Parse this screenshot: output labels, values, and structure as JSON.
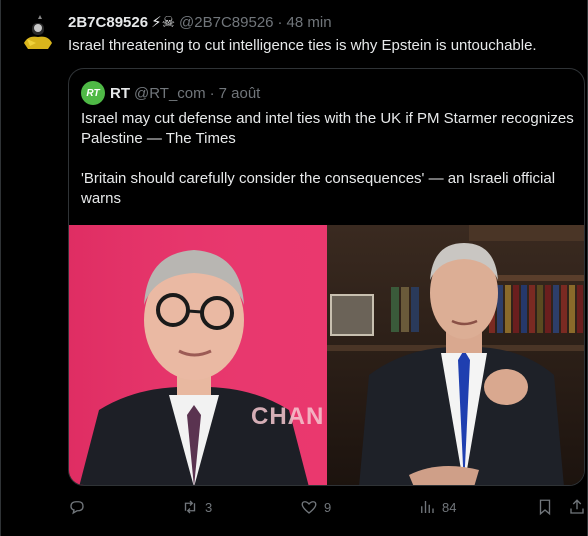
{
  "post": {
    "display_name": "2B7C89526",
    "badges": "⚡☠",
    "handle": "@2B7C89526",
    "separator": "·",
    "time": "48 min",
    "text": "Israel threatening to cut intelligence ties is why Epstein is untouchable."
  },
  "quote": {
    "avatar_text": "RT",
    "display_name": "RT",
    "handle": "@RT_com",
    "separator": "·",
    "time": "7 août",
    "paragraph1": "Israel may cut defense and intel ties with the UK if PM Starmer recognizes Palestine — The Times",
    "paragraph2": "'Britain should carefully consider the consequences' — an Israeli official warns",
    "image_sign_text": "CHAN"
  },
  "actions": {
    "reply_icon": "reply-icon",
    "reply_count": "",
    "repost_icon": "repost-icon",
    "repost_count": "3",
    "like_icon": "heart-icon",
    "like_count": "9",
    "views_icon": "views-icon",
    "views_count": "84",
    "bookmark_icon": "bookmark-icon",
    "share_icon": "share-icon"
  },
  "colors": {
    "background": "#000000",
    "text": "#e7e9ea",
    "muted": "#71767b",
    "border": "#2f3336",
    "rt_green": "#4fb946",
    "image_left_bg": "#e8326a"
  }
}
